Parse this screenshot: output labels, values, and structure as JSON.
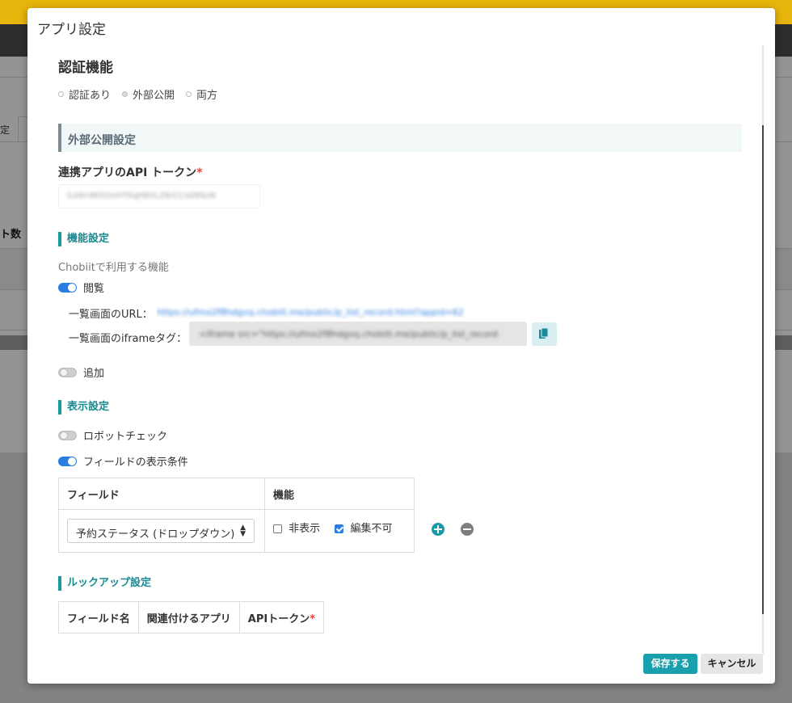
{
  "background": {
    "tab_fragment": "定",
    "column_fragment": "ト数"
  },
  "modal": {
    "title": "アプリ設定",
    "auth": {
      "heading": "認証機能",
      "options": [
        "認証あり",
        "外部公開",
        "両方"
      ],
      "selected": "外部公開"
    },
    "public_settings": {
      "heading": "外部公開設定",
      "token_label": "連携アプリのAPI トークン",
      "required_mark": "*",
      "token_value": "iLk6n4K02e4YfXqH8XLZ6rCCsDK6zN"
    },
    "feature_settings": {
      "heading": "機能設定",
      "note": "Chobiitで利用する機能",
      "view": {
        "label": "閲覧",
        "on": true
      },
      "list_url_label": "一覧画面のURL：",
      "list_url_value": "https://ufmo2f8hdgvq.chobiit.me/public/p_list_record.html?appid=62",
      "iframe_label": "一覧画面のiframeタグ：",
      "iframe_value": "<iframe src=\"https://ufmo2f8hdgvq.chobiit.me/public/p_list_record",
      "add": {
        "label": "追加",
        "on": false
      }
    },
    "display_settings": {
      "heading": "表示設定",
      "robot_check": {
        "label": "ロボットチェック",
        "on": false
      },
      "field_conditions": {
        "label": "フィールドの表示条件",
        "on": true
      },
      "table": {
        "headers": [
          "フィールド",
          "機能"
        ],
        "rows": [
          {
            "field": "予約ステータス (ドロップダウン)",
            "hide_label": "非表示",
            "hide_checked": false,
            "readonly_label": "編集不可",
            "readonly_checked": true
          }
        ]
      }
    },
    "lookup_settings": {
      "heading": "ルックアップ設定",
      "headers": [
        "フィールド名",
        "関連付けるアプリ",
        "APIトークン"
      ],
      "required_mark": "*"
    },
    "footer": {
      "save_label": "保存する",
      "cancel_label": "キャンセル"
    },
    "colors": {
      "accent": "#1aa0ad",
      "toggle_on": "#2a7de1",
      "required": "#e2453c",
      "topbar": "#e8b50c"
    }
  }
}
